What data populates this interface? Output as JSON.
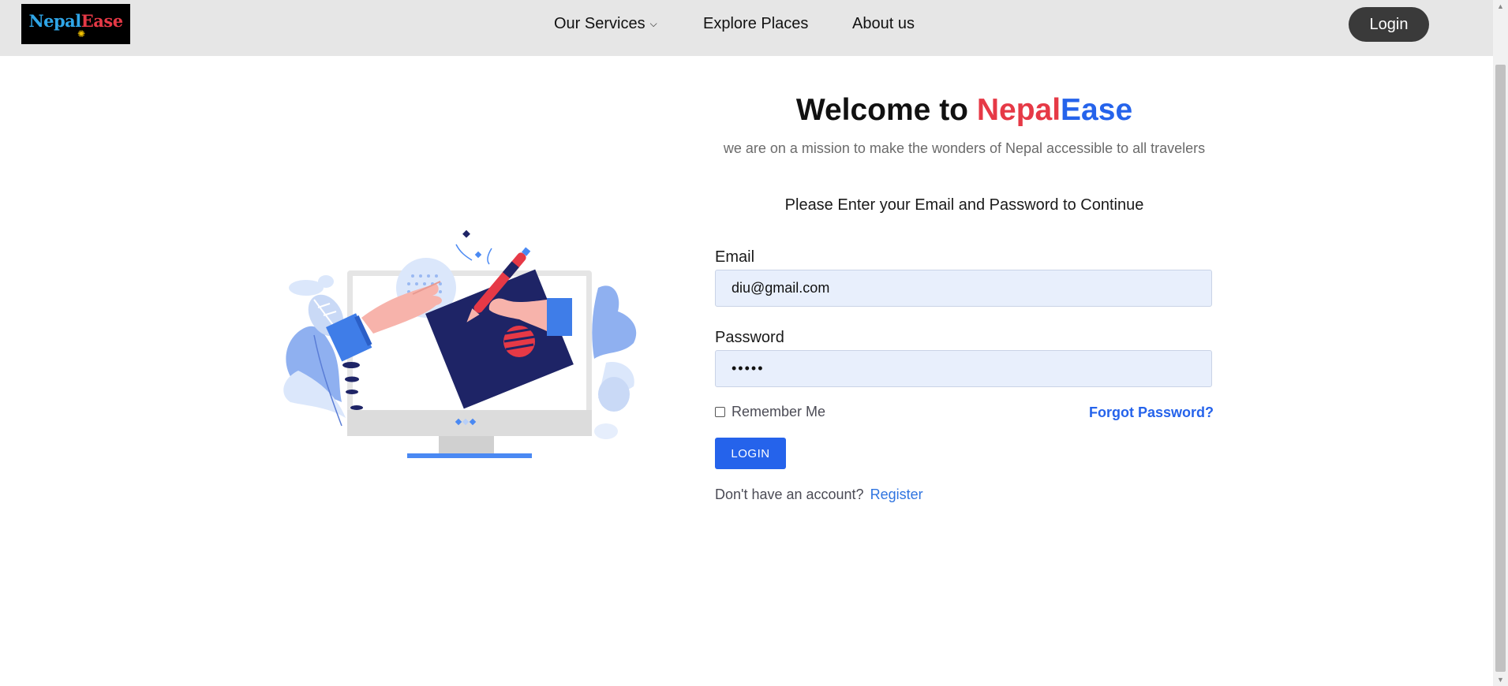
{
  "brand": {
    "name_part1": "Nepal",
    "name_part2": "Ease"
  },
  "nav": {
    "services": "Our Services",
    "explore": "Explore Places",
    "about": "About us",
    "login": "Login"
  },
  "hero": {
    "welcome_prefix": "Welcome to ",
    "welcome_red": "Nepal",
    "welcome_blue": "Ease",
    "subtitle": "we are on a mission to make the wonders of Nepal accessible to all travelers"
  },
  "form": {
    "instruction": "Please Enter your Email and Password to Continue",
    "email_label": "Email",
    "email_value": "diu@gmail.com",
    "password_label": "Password",
    "password_value": "•••••",
    "remember_label": "Remember Me",
    "remember_checked": false,
    "forgot": "Forgot Password?",
    "submit": "LOGIN",
    "no_account": "Don't have an account?",
    "register": "Register"
  },
  "colors": {
    "accent_red": "#e63946",
    "accent_blue": "#2563eb",
    "nav_bg": "#e6e6e6",
    "input_bg": "#e8effc"
  }
}
